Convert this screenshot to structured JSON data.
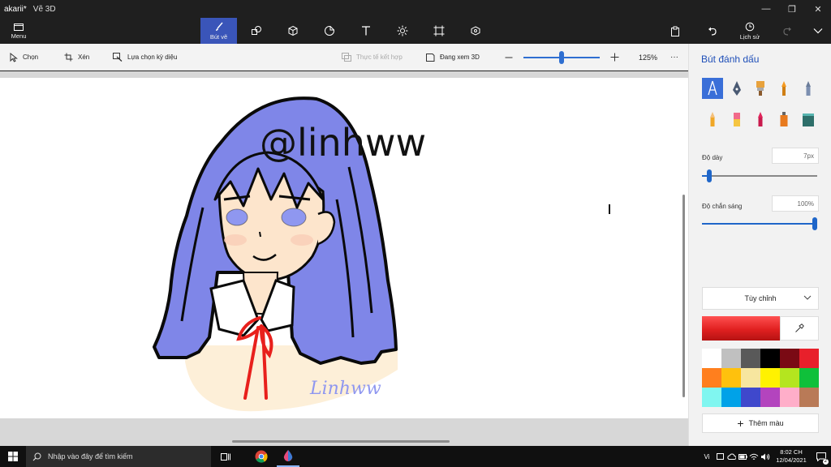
{
  "window": {
    "app_name": "akarii*",
    "doc_name": "Vẽ 3D",
    "minimize_glyph": "—",
    "maximize_glyph": "❐",
    "close_glyph": "✕"
  },
  "toolbar": {
    "menu_label": "Menu",
    "brushes_label": "Bút vẽ",
    "history_label": "Lịch sử",
    "tools": [
      "2d-shapes-icon",
      "3d-shapes-icon",
      "stickers-icon",
      "text-icon",
      "effects-icon",
      "canvas-icon",
      "3d-library-icon"
    ]
  },
  "command_bar": {
    "select_label": "Chọn",
    "crop_label": "Xén",
    "magic_select_label": "Lựa chọn kỳ diệu",
    "mixed_reality_label": "Thực tế kết hợp",
    "view_3d_label": "Đang xem 3D",
    "zoom_value": "125%",
    "zoom_fraction": 0.5,
    "more_label": "···"
  },
  "canvas": {
    "watermark_big": "@linhww",
    "signature": "Linhww"
  },
  "panel": {
    "title": "Bút đánh dấu",
    "brushes": [
      {
        "name": "marker",
        "selected": true
      },
      {
        "name": "calligraphy-pen",
        "selected": false
      },
      {
        "name": "oil-brush",
        "selected": false
      },
      {
        "name": "watercolor",
        "selected": false
      },
      {
        "name": "pixel-pen",
        "selected": false
      },
      {
        "name": "pencil",
        "selected": false
      },
      {
        "name": "eraser",
        "selected": false
      },
      {
        "name": "crayon",
        "selected": false
      },
      {
        "name": "spray-can",
        "selected": false
      },
      {
        "name": "fill",
        "selected": false
      }
    ],
    "thickness_label": "Độ dày",
    "thickness_value": "7px",
    "thickness_fraction": 0.06,
    "opacity_label": "Độ chắn sáng",
    "opacity_value": "100%",
    "opacity_fraction": 1.0,
    "color_mode": "Tùy chỉnh",
    "current_color": "#e02020",
    "swatches": [
      "#ffffff",
      "#c0c0c0",
      "#595959",
      "#000000",
      "#7a0a14",
      "#e8202b",
      "#ff7f1e",
      "#ffc10d",
      "#f7e69f",
      "#fff200",
      "#b4e51f",
      "#0fc03a",
      "#80f6f0",
      "#00a2e8",
      "#3f48cc",
      "#b344be",
      "#ffaec9",
      "#b97a57"
    ],
    "add_color_label": "Thêm màu"
  },
  "taskbar": {
    "search_placeholder": "Nhập vào đây để tìm kiếm",
    "language": "Vi",
    "time": "8:02 CH",
    "date": "12/04/2021",
    "notifications": "2"
  }
}
